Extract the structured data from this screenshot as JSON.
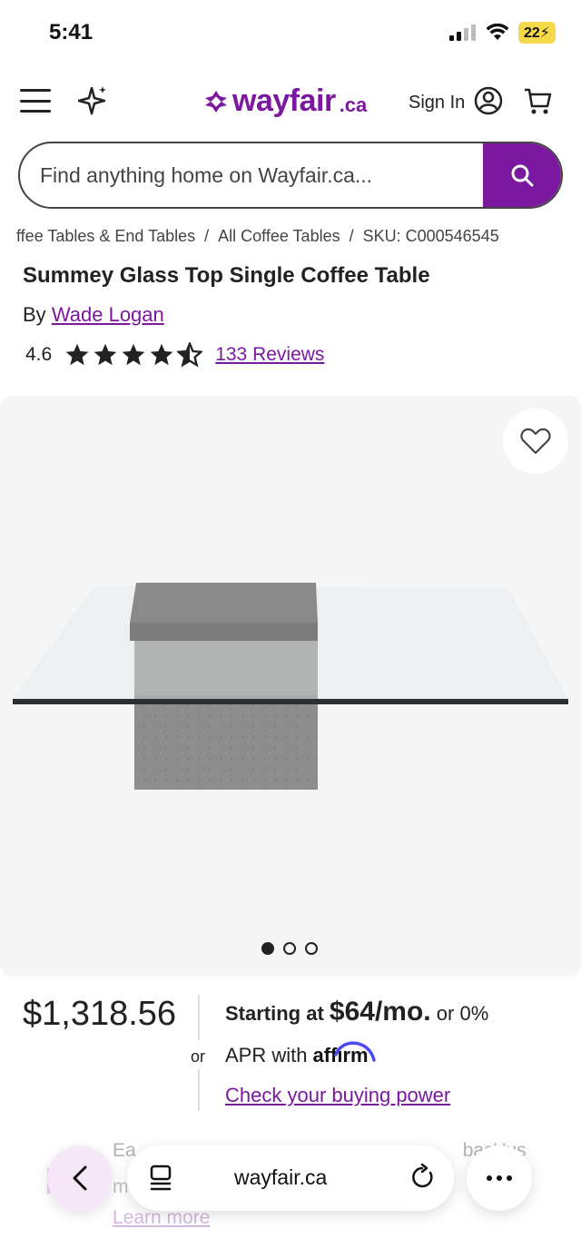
{
  "status_bar": {
    "time": "5:41",
    "battery": "22"
  },
  "header": {
    "logo_text": "wayfair",
    "logo_suffix": ".ca",
    "sign_in": "Sign In"
  },
  "search": {
    "placeholder": "Find anything home on Wayfair.ca..."
  },
  "breadcrumb": {
    "items": [
      "ffee Tables & End Tables",
      "All Coffee Tables",
      "SKU: C000546545"
    ],
    "separator": "/"
  },
  "product": {
    "title": "Summey Glass Top Single Coffee Table",
    "by_label": "By",
    "brand": "Wade Logan",
    "rating": "4.6",
    "rating_value": 4.6,
    "rating_max": 5,
    "reviews": "133 Reviews"
  },
  "gallery": {
    "image_count": 3,
    "active_index": 0
  },
  "pricing": {
    "price": "$1,318.56",
    "or": "or",
    "starting_at": "Starting at",
    "monthly": "$64/mo.",
    "or_apr": "or 0%",
    "apr_with": "APR with",
    "affirm": "affirm",
    "check_power": "Check your buying power"
  },
  "offer": {
    "line1": "Ea",
    "line1_end": "bac' 'us",
    "line2": "m",
    "learn_more": "Learn more"
  },
  "browser": {
    "url": "wayfair.ca"
  },
  "colors": {
    "brand": "#7b189f",
    "gallery_bg": "#f5f5f5"
  }
}
